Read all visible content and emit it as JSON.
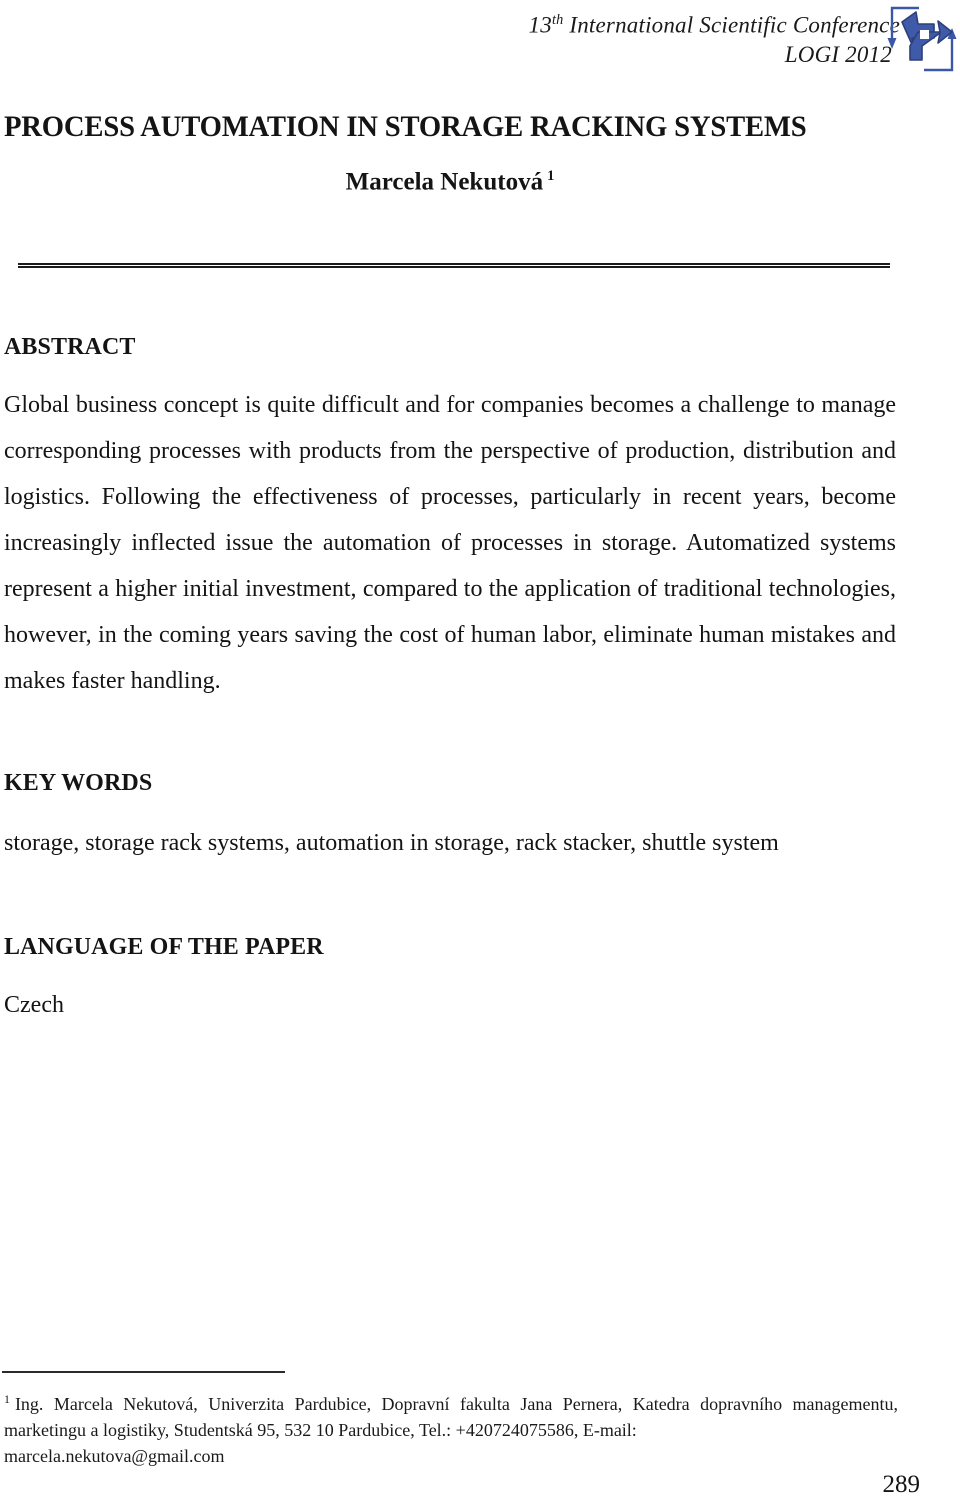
{
  "header": {
    "conference_line1_prefix": "13",
    "conference_line1_sup": "th",
    "conference_line1_rest": " International Scientific Conference",
    "conference_line2": "LOGI 2012",
    "logo_name": "logi-cycle-arrows-logo",
    "logo_color": "#3a57a8"
  },
  "title": "PROCESS AUTOMATION IN STORAGE RACKING SYSTEMS",
  "author": {
    "name": "Marcela Nekutová",
    "footnote_marker": "1"
  },
  "sections": {
    "abstract": {
      "heading": "ABSTRACT",
      "text": "Global business concept is quite difficult and for companies becomes a challenge to manage corresponding processes with products from the perspective of production, distribution and logistics. Following the effectiveness of processes, particularly in recent years, become increasingly inflected issue the automation of processes in storage. Automatized systems represent a higher initial investment, compared to the application of traditional technologies, however, in the coming years saving the cost of human labor, eliminate human mistakes and makes faster handling."
    },
    "keywords": {
      "heading": "KEY WORDS",
      "text": "storage, storage rack systems, automation in storage, rack stacker, shuttle system"
    },
    "language": {
      "heading": "LANGUAGE OF THE PAPER",
      "text": "Czech"
    }
  },
  "footnote": {
    "marker": "1",
    "text": "Ing. Marcela Nekutová, Univerzita Pardubice, Dopravní fakulta Jana Pernera,   Katedra dopravního managementu, marketingu a logistiky, Studentská 95, 532 10 Pardubice, Tel.: +420724075586, E-mail:",
    "email": "marcela.nekutova@gmail.com"
  },
  "page_number": "289"
}
